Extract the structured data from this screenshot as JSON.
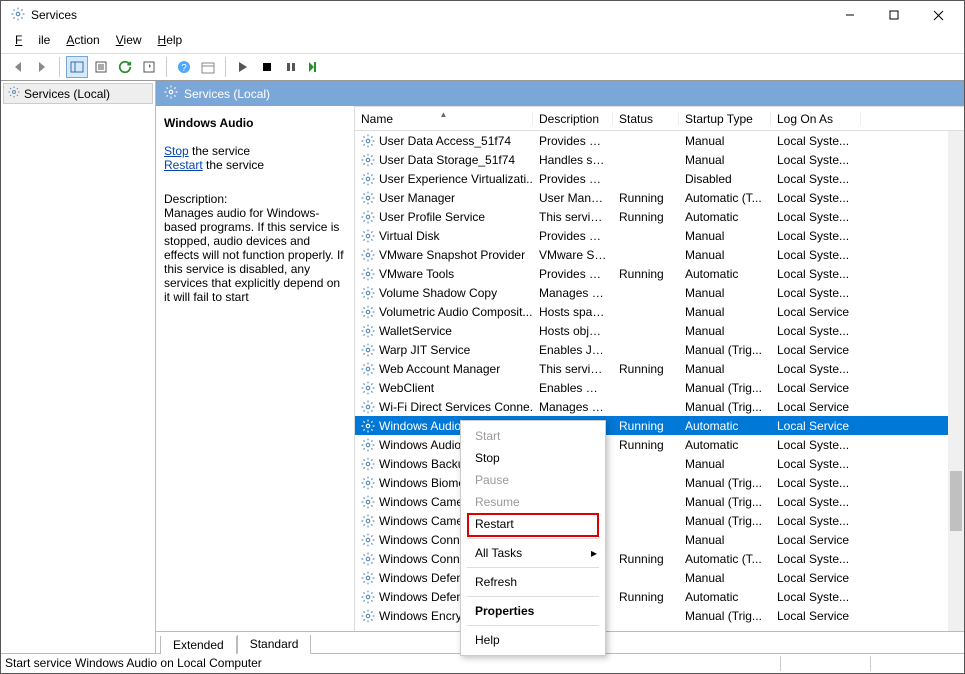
{
  "window": {
    "title": "Services"
  },
  "menu": {
    "file": "File",
    "action": "Action",
    "view": "View",
    "help": "Help"
  },
  "nav": {
    "root": "Services (Local)"
  },
  "panel": {
    "header": "Services (Local)"
  },
  "detail": {
    "service_name": "Windows Audio",
    "stop_link": "Stop",
    "stop_suffix": " the service",
    "restart_link": "Restart",
    "restart_suffix": " the service",
    "desc_label": "Description:",
    "description": "Manages audio for Windows-based programs.  If this service is stopped, audio devices and effects will not function properly.  If this service is disabled, any services that explicitly depend on it will fail to start"
  },
  "columns": {
    "name": "Name",
    "description": "Description",
    "status": "Status",
    "startup": "Startup Type",
    "logon": "Log On As"
  },
  "tabs": {
    "extended": "Extended",
    "standard": "Standard"
  },
  "statusbar": "Start service Windows Audio on Local Computer",
  "context_menu": {
    "start": "Start",
    "stop": "Stop",
    "pause": "Pause",
    "resume": "Resume",
    "restart": "Restart",
    "all_tasks": "All Tasks",
    "refresh": "Refresh",
    "properties": "Properties",
    "help": "Help"
  },
  "rows": [
    {
      "name": "User Data Access_51f74",
      "desc": "Provides ap...",
      "status": "",
      "startup": "Manual",
      "logon": "Local Syste..."
    },
    {
      "name": "User Data Storage_51f74",
      "desc": "Handles sto...",
      "status": "",
      "startup": "Manual",
      "logon": "Local Syste..."
    },
    {
      "name": "User Experience Virtualizati...",
      "desc": "Provides su...",
      "status": "",
      "startup": "Disabled",
      "logon": "Local Syste..."
    },
    {
      "name": "User Manager",
      "desc": "User Manag...",
      "status": "Running",
      "startup": "Automatic (T...",
      "logon": "Local Syste..."
    },
    {
      "name": "User Profile Service",
      "desc": "This service ...",
      "status": "Running",
      "startup": "Automatic",
      "logon": "Local Syste..."
    },
    {
      "name": "Virtual Disk",
      "desc": "Provides m...",
      "status": "",
      "startup": "Manual",
      "logon": "Local Syste..."
    },
    {
      "name": "VMware Snapshot Provider",
      "desc": "VMware Sn...",
      "status": "",
      "startup": "Manual",
      "logon": "Local Syste..."
    },
    {
      "name": "VMware Tools",
      "desc": "Provides su...",
      "status": "Running",
      "startup": "Automatic",
      "logon": "Local Syste..."
    },
    {
      "name": "Volume Shadow Copy",
      "desc": "Manages an...",
      "status": "",
      "startup": "Manual",
      "logon": "Local Syste..."
    },
    {
      "name": "Volumetric Audio Composit...",
      "desc": "Hosts spatia...",
      "status": "",
      "startup": "Manual",
      "logon": "Local Service"
    },
    {
      "name": "WalletService",
      "desc": "Hosts objec...",
      "status": "",
      "startup": "Manual",
      "logon": "Local Syste..."
    },
    {
      "name": "Warp JIT Service",
      "desc": "Enables JIT ...",
      "status": "",
      "startup": "Manual (Trig...",
      "logon": "Local Service"
    },
    {
      "name": "Web Account Manager",
      "desc": "This service ...",
      "status": "Running",
      "startup": "Manual",
      "logon": "Local Syste..."
    },
    {
      "name": "WebClient",
      "desc": "Enables Win...",
      "status": "",
      "startup": "Manual (Trig...",
      "logon": "Local Service"
    },
    {
      "name": "Wi-Fi Direct Services Conne...",
      "desc": "Manages co...",
      "status": "",
      "startup": "Manual (Trig...",
      "logon": "Local Service"
    },
    {
      "name": "Windows Audio",
      "desc": "",
      "status": "Running",
      "startup": "Automatic",
      "logon": "Local Service",
      "selected": true
    },
    {
      "name": "Windows Audio En",
      "desc": "",
      "status": "Running",
      "startup": "Automatic",
      "logon": "Local Syste..."
    },
    {
      "name": "Windows Backup",
      "desc": "",
      "status": "",
      "startup": "Manual",
      "logon": "Local Syste..."
    },
    {
      "name": "Windows Biometric",
      "desc": "",
      "status": "",
      "startup": "Manual (Trig...",
      "logon": "Local Syste..."
    },
    {
      "name": "Windows Camera F",
      "desc": "",
      "status": "",
      "startup": "Manual (Trig...",
      "logon": "Local Syste..."
    },
    {
      "name": "Windows Camera F",
      "desc": "",
      "status": "",
      "startup": "Manual (Trig...",
      "logon": "Local Syste..."
    },
    {
      "name": "Windows Connect",
      "desc": "",
      "status": "",
      "startup": "Manual",
      "logon": "Local Service"
    },
    {
      "name": "Windows Connecti",
      "desc": "",
      "status": "Running",
      "startup": "Automatic (T...",
      "logon": "Local Syste..."
    },
    {
      "name": "Windows Defender",
      "desc": "",
      "status": "",
      "startup": "Manual",
      "logon": "Local Service"
    },
    {
      "name": "Windows Defender",
      "desc": "",
      "status": "Running",
      "startup": "Automatic",
      "logon": "Local Syste..."
    },
    {
      "name": "Windows Encryptic",
      "desc": "",
      "status": "",
      "startup": "Manual (Trig...",
      "logon": "Local Service"
    }
  ]
}
